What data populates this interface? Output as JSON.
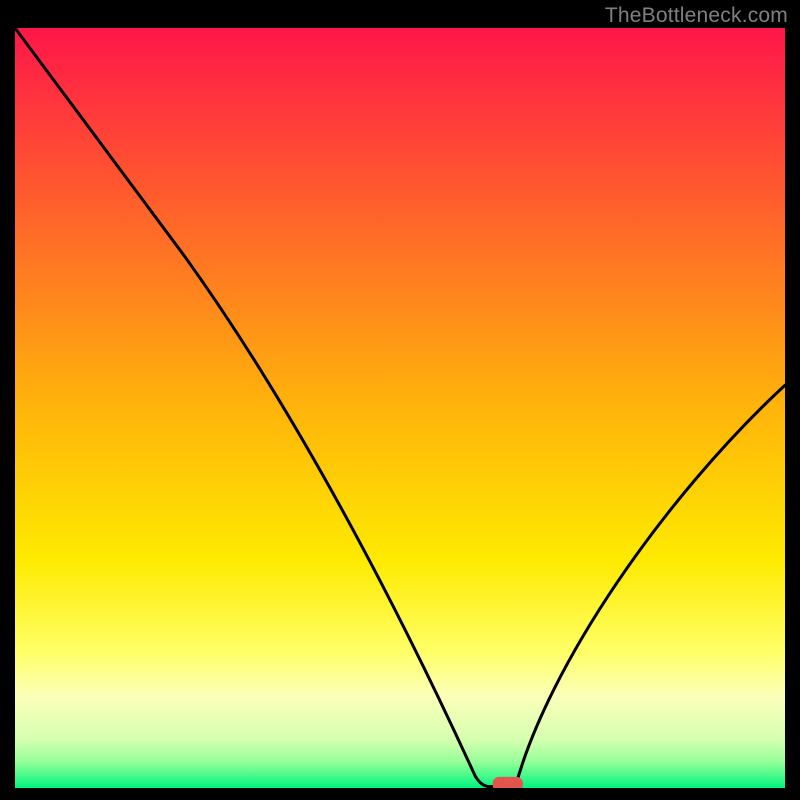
{
  "watermark": "TheBottleneck.com",
  "colors": {
    "bg": "#000000",
    "gradient_stops": [
      {
        "offset": 0.0,
        "color": "#ff1649"
      },
      {
        "offset": 0.5,
        "color": "#ffb40a"
      },
      {
        "offset": 0.7,
        "color": "#feea00"
      },
      {
        "offset": 0.82,
        "color": "#ffff66"
      },
      {
        "offset": 0.88,
        "color": "#fbffb9"
      },
      {
        "offset": 0.935,
        "color": "#d7ffb0"
      },
      {
        "offset": 0.965,
        "color": "#97ff99"
      },
      {
        "offset": 1.0,
        "color": "#00f57e"
      }
    ],
    "curve": "#000000",
    "marker_fill": "#e1554d",
    "marker_stroke": "#e1554d"
  },
  "chart_data": {
    "type": "line",
    "title": "",
    "xlabel": "",
    "ylabel": "",
    "xlim": [
      0,
      100
    ],
    "ylim": [
      0,
      100
    ],
    "x": [
      0,
      8,
      15,
      22,
      30,
      38,
      46,
      52,
      56,
      59,
      61,
      63,
      65,
      68,
      71,
      75,
      80,
      86,
      92,
      100
    ],
    "values": [
      100,
      90,
      80,
      70,
      60,
      48,
      36,
      25,
      15,
      7,
      2,
      0,
      0,
      3,
      9,
      17,
      26,
      35,
      43,
      53
    ],
    "curve_segments": {
      "left_start": [
        0.0,
        100.0
      ],
      "left_knee": [
        22.0,
        70.0
      ],
      "valley_left": [
        59.8,
        1.5
      ],
      "valley_flat_start": [
        61.5,
        0.2
      ],
      "valley_flat_end": [
        65.0,
        0.2
      ],
      "right_end": [
        100.0,
        53.0
      ]
    },
    "marker": {
      "x": 64.0,
      "y": 0.5,
      "rx": 1.9,
      "ry": 0.9
    }
  }
}
